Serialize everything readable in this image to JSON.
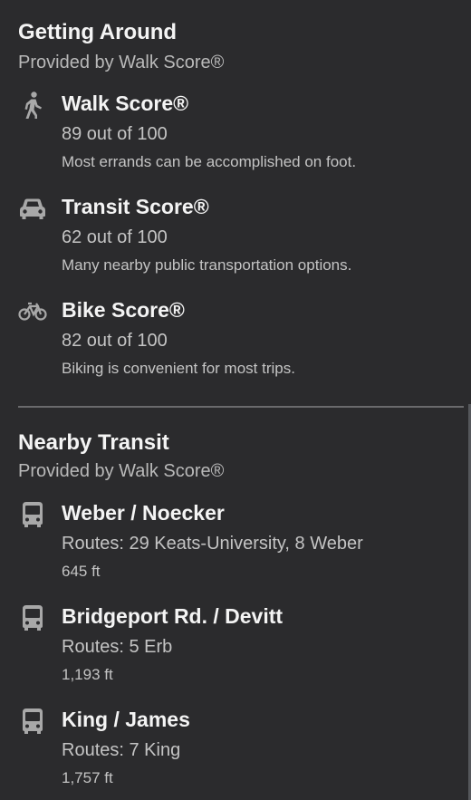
{
  "getting_around": {
    "title": "Getting Around",
    "subtitle": "Provided by Walk Score®",
    "items": [
      {
        "icon": "walk-icon",
        "title": "Walk Score®",
        "score": "89 out of 100",
        "description": "Most errands can be accomplished on foot."
      },
      {
        "icon": "car-icon",
        "title": "Transit Score®",
        "score": "62 out of 100",
        "description": "Many nearby public transportation options."
      },
      {
        "icon": "bike-icon",
        "title": "Bike Score®",
        "score": "82 out of 100",
        "description": "Biking is convenient for most trips."
      }
    ]
  },
  "nearby_transit": {
    "title": "Nearby Transit",
    "subtitle": "Provided by Walk Score®",
    "stops": [
      {
        "icon": "bus-icon",
        "name": "Weber / Noecker",
        "routes": "Routes: 29 Keats-University, 8 Weber",
        "distance": "645 ft"
      },
      {
        "icon": "bus-icon",
        "name": "Bridgeport Rd. / Devitt",
        "routes": "Routes: 5 Erb",
        "distance": "1,193 ft"
      },
      {
        "icon": "bus-icon",
        "name": "King / James",
        "routes": "Routes: 7 King",
        "distance": "1,757 ft"
      }
    ]
  },
  "colors": {
    "background": "#2b2b2d",
    "title_text": "#f4f4f4",
    "secondary_text": "#c4c4c4",
    "icon": "#a8a8a8",
    "divider": "#6a6a6c"
  }
}
